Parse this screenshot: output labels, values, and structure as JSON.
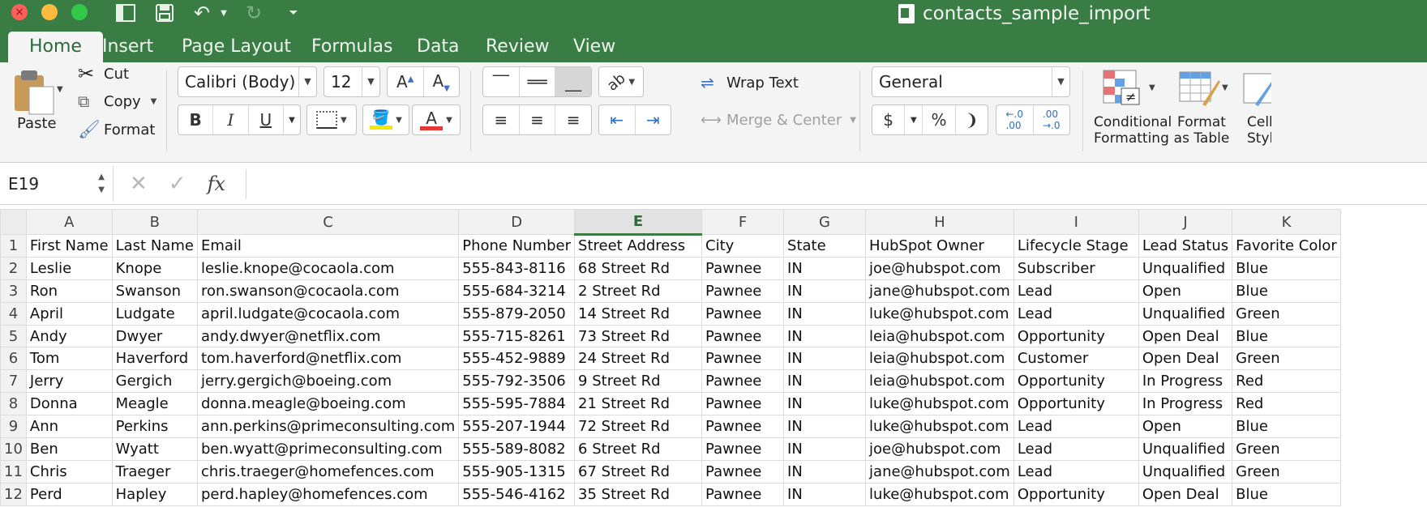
{
  "app": {
    "window_title": "contacts_sample_import",
    "colors": {
      "chrome_green": "#3a7d44",
      "ribbon_bg": "#f4f4f4",
      "active_col": "#3a7d44"
    }
  },
  "quick_access": {
    "icons": [
      "sidebar-toggle-icon",
      "save-icon",
      "undo-icon",
      "redo-icon",
      "customize-toolbar-icon"
    ]
  },
  "tabs": [
    {
      "label": "Home",
      "active": true
    },
    {
      "label": "Insert"
    },
    {
      "label": "Page Layout"
    },
    {
      "label": "Formulas"
    },
    {
      "label": "Data"
    },
    {
      "label": "Review"
    },
    {
      "label": "View"
    }
  ],
  "clipboard": {
    "paste": "Paste",
    "cut": "Cut",
    "copy": "Copy",
    "format": "Format"
  },
  "font": {
    "name": "Calibri (Body)",
    "size": "12",
    "bold": "B",
    "italic": "I",
    "underline": "U"
  },
  "alignment": {
    "wrap_text": "Wrap Text",
    "merge_center": "Merge & Center"
  },
  "number": {
    "format": "General",
    "currency": "$",
    "percent": "%",
    "comma": "❩"
  },
  "styles": {
    "conditional_formatting": [
      "Conditional",
      "Formatting"
    ],
    "format_as_table": [
      "Format",
      "as Table"
    ],
    "cell_styles": [
      "Cell",
      "Styles"
    ]
  },
  "formula_bar": {
    "cell_ref": "E19",
    "formula": "",
    "fx": "fx",
    "cancel": "✕",
    "enter": "✓"
  },
  "sheet": {
    "columns": [
      "A",
      "B",
      "C",
      "D",
      "E",
      "F",
      "G",
      "H",
      "I",
      "J",
      "K"
    ],
    "selected_column": "E",
    "rows": [
      [
        "First Name",
        "Last Name",
        "Email",
        "Phone Number",
        "Street Address",
        "City",
        "State",
        "HubSpot Owner",
        "Lifecycle Stage",
        "Lead Status",
        "Favorite Color"
      ],
      [
        "Leslie",
        "Knope",
        "leslie.knope@cocaola.com",
        "555-843-8116",
        "68 Street Rd",
        "Pawnee",
        "IN",
        "joe@hubspot.com",
        "Subscriber",
        "Unqualified",
        "Blue"
      ],
      [
        "Ron",
        "Swanson",
        "ron.swanson@cocaola.com",
        "555-684-3214",
        "2 Street Rd",
        "Pawnee",
        "IN",
        "jane@hubspot.com",
        "Lead",
        "Open",
        "Blue"
      ],
      [
        "April",
        "Ludgate",
        "april.ludgate@cocaola.com",
        "555-879-2050",
        "14 Street Rd",
        "Pawnee",
        "IN",
        "luke@hubspot.com",
        "Lead",
        "Unqualified",
        "Green"
      ],
      [
        "Andy",
        "Dwyer",
        "andy.dwyer@netflix.com",
        "555-715-8261",
        "73 Street Rd",
        "Pawnee",
        "IN",
        "leia@hubspot.com",
        "Opportunity",
        "Open Deal",
        "Blue"
      ],
      [
        "Tom",
        "Haverford",
        "tom.haverford@netflix.com",
        "555-452-9889",
        "24 Street Rd",
        "Pawnee",
        "IN",
        "leia@hubspot.com",
        "Customer",
        "Open Deal",
        "Green"
      ],
      [
        "Jerry",
        "Gergich",
        "jerry.gergich@boeing.com",
        "555-792-3506",
        "9 Street Rd",
        "Pawnee",
        "IN",
        "leia@hubspot.com",
        "Opportunity",
        "In Progress",
        "Red"
      ],
      [
        "Donna",
        "Meagle",
        "donna.meagle@boeing.com",
        "555-595-7884",
        "21 Street Rd",
        "Pawnee",
        "IN",
        "luke@hubspot.com",
        "Opportunity",
        "In Progress",
        "Red"
      ],
      [
        "Ann",
        "Perkins",
        "ann.perkins@primeconsulting.com",
        "555-207-1944",
        "72 Street Rd",
        "Pawnee",
        "IN",
        "luke@hubspot.com",
        "Lead",
        "Open",
        "Blue"
      ],
      [
        "Ben",
        "Wyatt",
        "ben.wyatt@primeconsulting.com",
        "555-589-8082",
        "6 Street Rd",
        "Pawnee",
        "IN",
        "joe@hubspot.com",
        "Lead",
        "Unqualified",
        "Green"
      ],
      [
        "Chris",
        "Traeger",
        "chris.traeger@homefences.com",
        "555-905-1315",
        "67 Street Rd",
        "Pawnee",
        "IN",
        "jane@hubspot.com",
        "Lead",
        "Unqualified",
        "Green"
      ],
      [
        "Perd",
        "Hapley",
        "perd.hapley@homefences.com",
        "555-546-4162",
        "35 Street Rd",
        "Pawnee",
        "IN",
        "luke@hubspot.com",
        "Opportunity",
        "Open Deal",
        "Blue"
      ]
    ]
  }
}
